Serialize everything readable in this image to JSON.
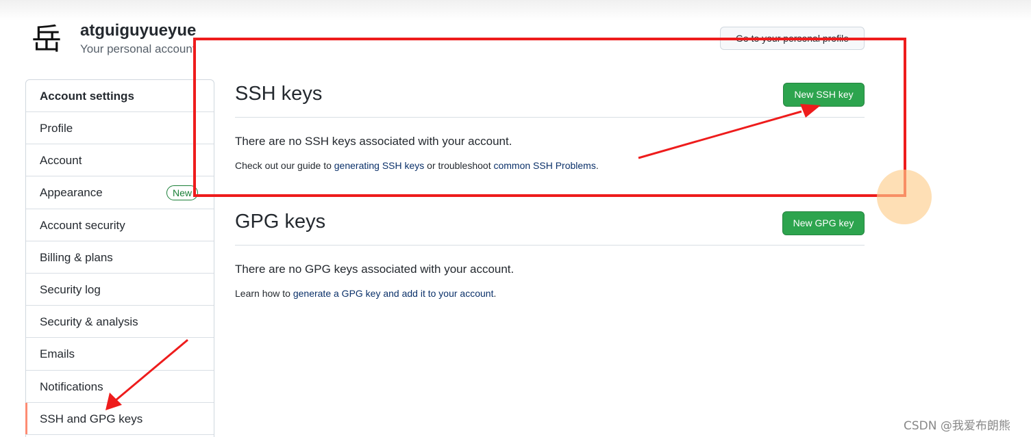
{
  "user": {
    "avatar_glyph": "岳",
    "username": "atguiguyueyue",
    "subtitle": "Your personal account",
    "profile_button": "Go to your personal profile"
  },
  "sidebar": {
    "header": "Account settings",
    "items": [
      {
        "label": "Profile"
      },
      {
        "label": "Account"
      },
      {
        "label": "Appearance",
        "badge": "New"
      },
      {
        "label": "Account security"
      },
      {
        "label": "Billing & plans"
      },
      {
        "label": "Security log"
      },
      {
        "label": "Security & analysis"
      },
      {
        "label": "Emails"
      },
      {
        "label": "Notifications"
      },
      {
        "label": "SSH and GPG keys",
        "active": true
      }
    ]
  },
  "ssh": {
    "title": "SSH keys",
    "button": "New SSH key",
    "empty_message": "There are no SSH keys associated with your account.",
    "hint_prefix": "Check out our guide to ",
    "hint_link1": "generating SSH keys",
    "hint_middle": " or troubleshoot ",
    "hint_link2": "common SSH Problems",
    "hint_suffix": "."
  },
  "gpg": {
    "title": "GPG keys",
    "button": "New GPG key",
    "empty_message": "There are no GPG keys associated with your account.",
    "hint_prefix": "Learn how to ",
    "hint_link": "generate a GPG key and add it to your account",
    "hint_suffix": "."
  },
  "watermark": "CSDN @我爱布朗熊",
  "colors": {
    "primary_button": "#2da44e",
    "link": "#0a3069",
    "active_indicator": "#fd8c73",
    "annotation_red": "#ee1c1c"
  }
}
